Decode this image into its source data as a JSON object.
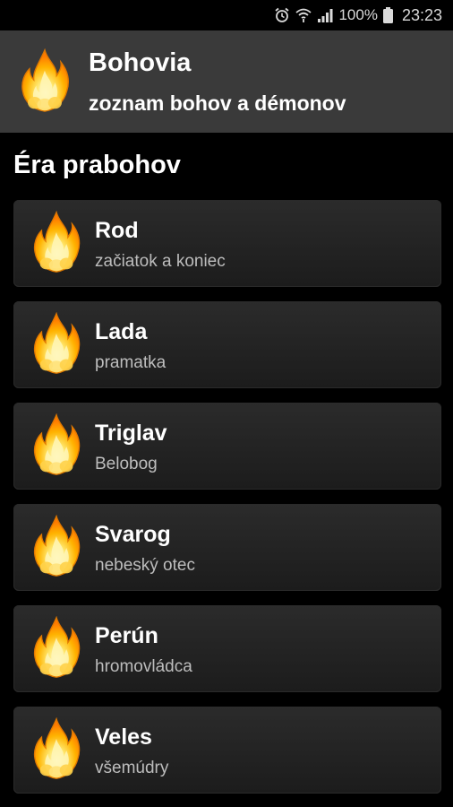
{
  "status_bar": {
    "icons": [
      "alarm-icon",
      "wifi-icon",
      "signal-icon",
      "battery-icon"
    ],
    "battery": "100%",
    "time": "23:23"
  },
  "app_bar": {
    "title": "Bohovia",
    "subtitle": "zoznam bohov a démonov",
    "logo_icon": "flame-icon"
  },
  "section": {
    "title": "Éra prabohov"
  },
  "items": [
    {
      "title": "Rod",
      "subtitle": "začiatok a koniec",
      "icon": "flame-icon"
    },
    {
      "title": "Lada",
      "subtitle": "pramatka",
      "icon": "flame-icon"
    },
    {
      "title": "Triglav",
      "subtitle": "Belobog",
      "icon": "flame-icon"
    },
    {
      "title": "Svarog",
      "subtitle": "nebeský otec",
      "icon": "flame-icon"
    },
    {
      "title": "Perún",
      "subtitle": "hromovládca",
      "icon": "flame-icon"
    },
    {
      "title": "Veles",
      "subtitle": "všemúdry",
      "icon": "flame-icon"
    }
  ],
  "colors": {
    "background": "#000000",
    "app_bar": "#3a3a3a",
    "card": "#232323",
    "flame_outer": "#f39c12",
    "flame_inner": "#fff3a0"
  }
}
